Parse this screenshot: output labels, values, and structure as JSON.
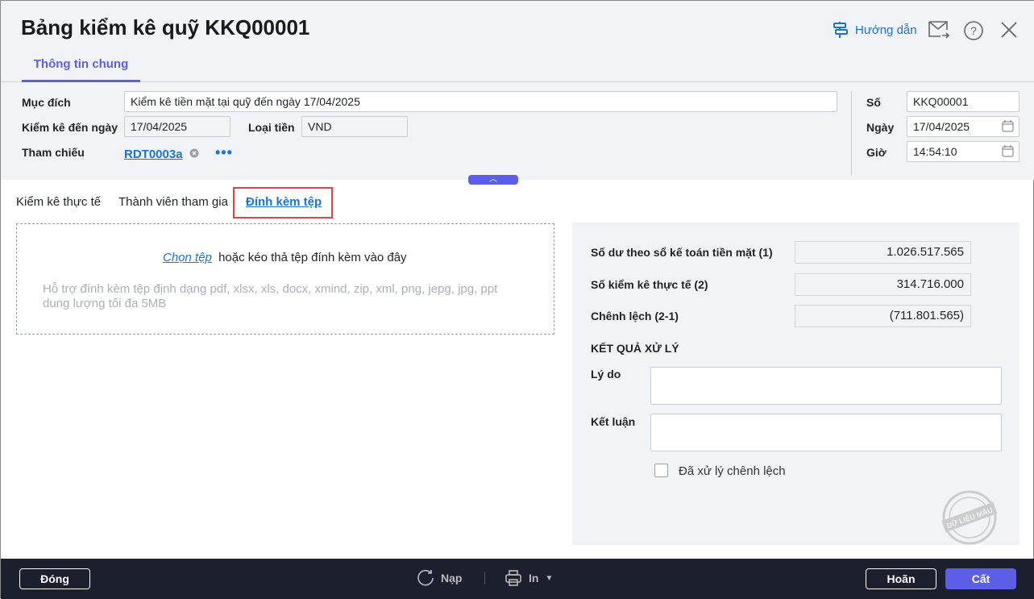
{
  "header": {
    "title": "Bảng kiểm kê quỹ KKQ00001",
    "guide_label": "Hướng dẫn",
    "tab": "Thông tin chung"
  },
  "form": {
    "muc_dich_label": "Mục đích",
    "muc_dich": "Kiểm kê tiền mặt tại quỹ đến ngày 17/04/2025",
    "kiem_ke_den_ngay_label": "Kiểm kê đến ngày",
    "kiem_ke_den_ngay": "17/04/2025",
    "loai_tien_label": "Loại tiền",
    "loai_tien": "VND",
    "tham_chieu_label": "Tham chiếu",
    "tham_chieu": "RDT0003a",
    "so_label": "Số",
    "so": "KKQ00001",
    "ngay_label": "Ngày",
    "ngay": "17/04/2025",
    "gio_label": "Giờ",
    "gio": "14:54:10"
  },
  "subtabs": [
    "Kiểm kê thực tế",
    "Thành viên tham gia",
    "Đính kèm tệp"
  ],
  "attach": {
    "choose": "Chọn tệp",
    "drop_text": "hoặc kéo thả tệp đính kèm vào đây",
    "hint1": "Hỗ trợ đính kèm tệp định dạng pdf, xlsx, xls, docx, xmind, zip, xml, png, jepg, jpg, ppt",
    "hint2": "dung lượng tối đa 5MB"
  },
  "summary": {
    "so_du_label": "Số dư theo sổ kế toán tiền mặt (1)",
    "so_du": "1.026.517.565",
    "kiem_ke_label": "Số kiểm kê thực tế (2)",
    "kiem_ke": "314.716.000",
    "chenh_lech_label": "Chênh lệch (2-1)",
    "chenh_lech": "(711.801.565)",
    "result_title": "KẾT QUẢ XỬ LÝ",
    "ly_do_label": "Lý do",
    "ly_do": "",
    "ket_luan_label": "Kết luận",
    "ket_luan": "",
    "checkbox_label": "Đã xử lý chênh lệch",
    "checked": false,
    "stamp": "DỮ LIỆU MẪU"
  },
  "footer": {
    "close": "Đóng",
    "reload": "Nạp",
    "print": "In",
    "cancel": "Hoãn",
    "save": "Cất"
  },
  "colors": {
    "accent": "#5b5fe6",
    "link": "#1a73d9",
    "footer": "#1c1f2e"
  }
}
